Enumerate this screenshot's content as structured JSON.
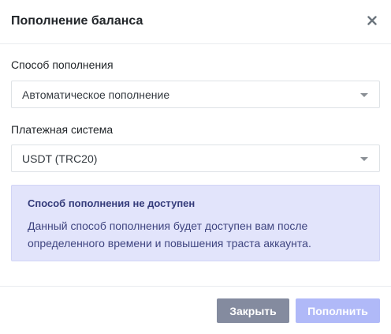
{
  "modal": {
    "title": "Пополнение баланса",
    "close_icon": "close-icon"
  },
  "method": {
    "label": "Способ пополнения",
    "selected": "Автоматическое пополнение"
  },
  "payment_system": {
    "label": "Платежная система",
    "selected": "USDT (TRC20)"
  },
  "alert": {
    "title": "Способ пополнения не доступен",
    "text": "Данный способ пополнения будет доступен вам после определенного времени и повышения траста аккаунта."
  },
  "footer": {
    "close_label": "Закрыть",
    "submit_label": "Пополнить"
  },
  "colors": {
    "alert_bg": "#e2e4fb",
    "close_button": "#848b9f",
    "submit_button_disabled": "#b0b9f8"
  }
}
